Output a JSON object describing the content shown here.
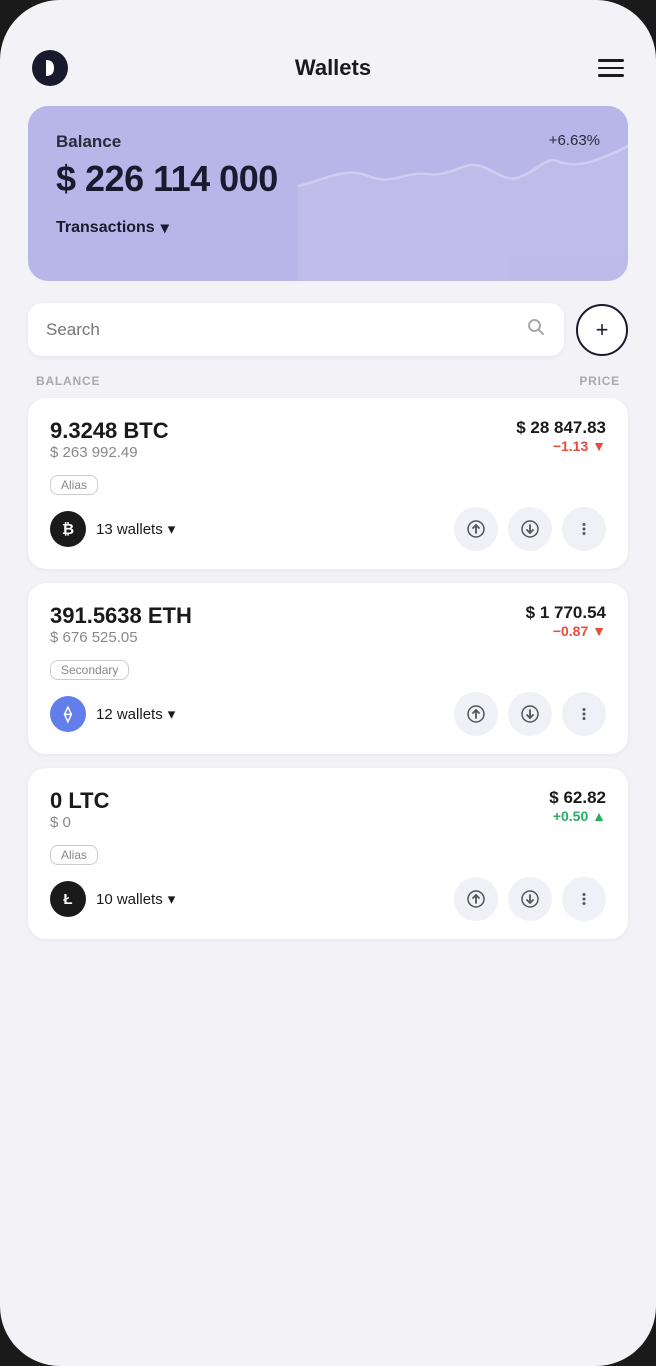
{
  "header": {
    "title": "Wallets",
    "menu_label": "menu"
  },
  "balance_card": {
    "label": "Balance",
    "change": "+6.63%",
    "amount": "$ 226 114 000",
    "transactions_label": "Transactions"
  },
  "search": {
    "placeholder": "Search",
    "add_label": "+"
  },
  "col_headers": {
    "balance": "BALANCE",
    "price": "PRICE"
  },
  "coins": [
    {
      "amount": "9.3248 BTC",
      "usd_value": "$ 263 992.49",
      "price": "$ 28 847.83",
      "change": "−1.13 ▼",
      "change_type": "neg",
      "alias": "Alias",
      "wallets": "13 wallets",
      "symbol": "₿",
      "logo_color": "#1a1a1a"
    },
    {
      "amount": "391.5638 ETH",
      "usd_value": "$ 676 525.05",
      "price": "$ 1 770.54",
      "change": "−0.87 ▼",
      "change_type": "neg",
      "alias": "Secondary",
      "wallets": "12 wallets",
      "symbol": "⟠",
      "logo_color": "#627eea"
    },
    {
      "amount": "0 LTC",
      "usd_value": "$ 0",
      "price": "$ 62.82",
      "change": "+0.50 ▲",
      "change_type": "pos",
      "alias": "Alias",
      "wallets": "10 wallets",
      "symbol": "Ł",
      "logo_color": "#1a1a1a"
    }
  ]
}
